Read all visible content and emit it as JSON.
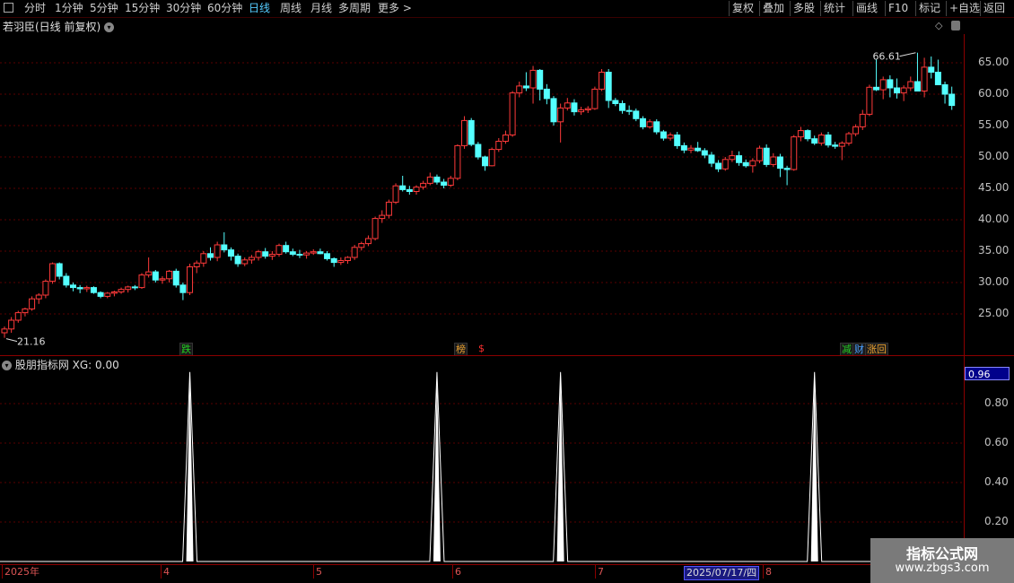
{
  "toolbar": {
    "periods": [
      "分时",
      "1分钟",
      "5分钟",
      "15分钟",
      "30分钟",
      "60分钟",
      "日线",
      "周线",
      "月线",
      "多周期",
      "更多 >"
    ],
    "active_period": "日线",
    "right_buttons": [
      "复权",
      "叠加",
      "多股",
      "统计",
      "画线",
      "F10",
      "标记",
      "+自选",
      "返回"
    ]
  },
  "chart": {
    "title": "若羽臣(日线 前复权)",
    "max_label": "66.61",
    "min_label": "21.16",
    "price_axis": [
      "65.00",
      "60.00",
      "55.00",
      "50.00",
      "45.00",
      "40.00",
      "35.00",
      "30.00",
      "25.00"
    ],
    "signals": [
      {
        "text": "跌",
        "color": "#22cc22"
      },
      {
        "text": "榜",
        "color": "#e8a030"
      },
      {
        "text": "$",
        "color": "#ff3030"
      },
      {
        "text": "减",
        "color": "#22cc22"
      },
      {
        "text": "财",
        "color": "#4aa0ff"
      },
      {
        "text": "涨回",
        "color": "#e8a030"
      }
    ]
  },
  "indicator": {
    "title": "股朋指标网 XG: 0.00",
    "current_value": "0.96",
    "axis": [
      "0.80",
      "0.60",
      "0.40",
      "0.20"
    ]
  },
  "date_axis": {
    "labels": [
      "2025年",
      "4",
      "5",
      "6",
      "7",
      "8"
    ],
    "cursor_date": "2025/07/17/四"
  },
  "watermark": {
    "line1": "指标公式网",
    "line2": "www.zbgs3.com"
  },
  "chart_data": {
    "type": "candlestick",
    "title": "若羽臣(日线 前复权)",
    "ohlc": [
      [
        22,
        23,
        21.2,
        22.6
      ],
      [
        22.6,
        24.5,
        22,
        24
      ],
      [
        24,
        25.5,
        23.6,
        25.2
      ],
      [
        25.2,
        26,
        24.6,
        25.8
      ],
      [
        25.8,
        27.8,
        25.5,
        27.4
      ],
      [
        27.4,
        28.3,
        26.6,
        28
      ],
      [
        28,
        30.5,
        27.5,
        30.2
      ],
      [
        30.2,
        33.2,
        29.8,
        33
      ],
      [
        33,
        33.2,
        30.5,
        31
      ],
      [
        31,
        31.5,
        29.2,
        29.6
      ],
      [
        29.6,
        30,
        28.6,
        29.2
      ],
      [
        29.2,
        29.6,
        28.3,
        29
      ],
      [
        29,
        29.5,
        28.5,
        29.2
      ],
      [
        29.2,
        29.4,
        28.2,
        28.4
      ],
      [
        28.4,
        28.6,
        27.5,
        27.8
      ],
      [
        27.8,
        28.5,
        27.5,
        28.3
      ],
      [
        28.3,
        28.7,
        27.8,
        28.5
      ],
      [
        28.5,
        29.2,
        28.2,
        28.9
      ],
      [
        28.9,
        29.5,
        28.4,
        29.3
      ],
      [
        29.3,
        29.6,
        28.8,
        29.2
      ],
      [
        29.2,
        31.5,
        29,
        31.2
      ],
      [
        31.2,
        34,
        30.8,
        31.7
      ],
      [
        31.7,
        32,
        30,
        30.4
      ],
      [
        30.4,
        31,
        29.8,
        30.6
      ],
      [
        30.6,
        32,
        30,
        31.8
      ],
      [
        31.8,
        32.2,
        29.2,
        29.6
      ],
      [
        29.6,
        30,
        27.2,
        28.4
      ],
      [
        28.4,
        33,
        28,
        32.5
      ],
      [
        32.5,
        33.5,
        31.5,
        33.1
      ],
      [
        33.1,
        35,
        32.5,
        34.6
      ],
      [
        34.6,
        35.6,
        33.5,
        34
      ],
      [
        34,
        36.5,
        33.4,
        36
      ],
      [
        36,
        38,
        34.8,
        35.2
      ],
      [
        35.2,
        35.6,
        33.5,
        34.2
      ],
      [
        34.2,
        34.6,
        32.5,
        33
      ],
      [
        33,
        34,
        32.6,
        33.6
      ],
      [
        33.6,
        34.4,
        33,
        34
      ],
      [
        34,
        35.2,
        33.5,
        34.9
      ],
      [
        34.9,
        35.5,
        33.8,
        34.2
      ],
      [
        34.2,
        35,
        33.6,
        34.5
      ],
      [
        34.5,
        36.2,
        34.1,
        35.9
      ],
      [
        35.9,
        36.5,
        34.6,
        34.9
      ],
      [
        34.9,
        35.4,
        34.2,
        34.5
      ],
      [
        34.5,
        35.2,
        33.9,
        34.4
      ],
      [
        34.4,
        35,
        33.8,
        34.7
      ],
      [
        34.7,
        35.3,
        34.4,
        34.9
      ],
      [
        34.9,
        35.4,
        34.5,
        34.6
      ],
      [
        34.6,
        35,
        33.5,
        33.8
      ],
      [
        33.8,
        34,
        32.5,
        33.2
      ],
      [
        33.2,
        34,
        32.8,
        33.5
      ],
      [
        33.5,
        34.2,
        33,
        34
      ],
      [
        34,
        36,
        33.6,
        35.6
      ],
      [
        35.6,
        36.5,
        35.1,
        36.2
      ],
      [
        36.2,
        37.5,
        35.8,
        37
      ],
      [
        37,
        40.5,
        36.7,
        40.2
      ],
      [
        40.2,
        41.5,
        39.5,
        40.7
      ],
      [
        40.7,
        43.2,
        40.2,
        42.8
      ],
      [
        42.8,
        45.8,
        42.5,
        45.4
      ],
      [
        45.4,
        47,
        44.5,
        44.8
      ],
      [
        44.8,
        45.4,
        44,
        44.5
      ],
      [
        44.5,
        45.5,
        44,
        45.2
      ],
      [
        45.2,
        46.2,
        44.8,
        45.8
      ],
      [
        45.8,
        47.5,
        45.5,
        46.8
      ],
      [
        46.8,
        47.2,
        45.6,
        46
      ],
      [
        46,
        46.5,
        45,
        45.5
      ],
      [
        45.5,
        47,
        45.2,
        46.6
      ],
      [
        46.6,
        52,
        46.3,
        51.8
      ],
      [
        51.8,
        56.5,
        51.3,
        55.8
      ],
      [
        55.8,
        56.2,
        51.7,
        52
      ],
      [
        52,
        52.4,
        49.6,
        50
      ],
      [
        50,
        50.2,
        47.8,
        48.6
      ],
      [
        48.6,
        51.5,
        48.5,
        51.2
      ],
      [
        51.2,
        53,
        50.8,
        52.5
      ],
      [
        52.5,
        54.2,
        52.1,
        53.5
      ],
      [
        53.5,
        60.5,
        53.2,
        60.2
      ],
      [
        60.2,
        62,
        59.5,
        61.3
      ],
      [
        61.3,
        63.5,
        60.5,
        61
      ],
      [
        61,
        64.5,
        58.5,
        63.8
      ],
      [
        63.8,
        64,
        59,
        60.8
      ],
      [
        60.8,
        61.6,
        58.4,
        59.3
      ],
      [
        59.3,
        59.7,
        55,
        55.6
      ],
      [
        55.6,
        58.5,
        52.3,
        57.8
      ],
      [
        57.8,
        59.4,
        57.4,
        58.6
      ],
      [
        58.6,
        59.2,
        56.6,
        57.2
      ],
      [
        57.2,
        58,
        56.7,
        57.5
      ],
      [
        57.5,
        58.1,
        57,
        57.7
      ],
      [
        57.7,
        61.2,
        57.5,
        60.8
      ],
      [
        60.8,
        64,
        60.5,
        63.5
      ],
      [
        63.5,
        64,
        57.8,
        59
      ],
      [
        59,
        59.4,
        58.1,
        58.5
      ],
      [
        58.5,
        59,
        56.9,
        57.4
      ],
      [
        57.4,
        58.2,
        56.7,
        57.3
      ],
      [
        57.3,
        57.7,
        55.7,
        56.1
      ],
      [
        56.1,
        56.5,
        54.4,
        54.8
      ],
      [
        54.8,
        56,
        54.5,
        55.6
      ],
      [
        55.6,
        56,
        53.6,
        54
      ],
      [
        54,
        54.3,
        52.6,
        53
      ],
      [
        53,
        53.9,
        52.6,
        53.5
      ],
      [
        53.5,
        54,
        51.3,
        51.8
      ],
      [
        51.8,
        52.3,
        50.6,
        51.1
      ],
      [
        51.1,
        51.9,
        50.6,
        51.4
      ],
      [
        51.4,
        52.4,
        50.8,
        51
      ],
      [
        51,
        51.4,
        49.8,
        50.3
      ],
      [
        50.3,
        50.8,
        48.4,
        49
      ],
      [
        49,
        49.5,
        47.6,
        48.1
      ],
      [
        48.1,
        50,
        47.8,
        49.6
      ],
      [
        49.6,
        51,
        49.2,
        50.2
      ],
      [
        50.2,
        50.9,
        48.6,
        49.1
      ],
      [
        49.1,
        49.6,
        48.3,
        48.6
      ],
      [
        48.6,
        49.8,
        47.5,
        49.4
      ],
      [
        49.4,
        51.8,
        49,
        51.4
      ],
      [
        51.4,
        52,
        48.4,
        48.8
      ],
      [
        48.8,
        50.6,
        48.4,
        50
      ],
      [
        50,
        50.5,
        46.8,
        48.2
      ],
      [
        48.2,
        48.6,
        45.5,
        48
      ],
      [
        48,
        53.5,
        47.8,
        53.2
      ],
      [
        53.2,
        54.8,
        52.5,
        54.2
      ],
      [
        54.2,
        54.4,
        52.5,
        52.9
      ],
      [
        52.9,
        53.4,
        51.9,
        52.2
      ],
      [
        52.2,
        53.9,
        51.8,
        53.5
      ],
      [
        53.5,
        54,
        51.5,
        51.9
      ],
      [
        51.9,
        52.4,
        51.3,
        51.7
      ],
      [
        51.7,
        52.5,
        49.5,
        52.2
      ],
      [
        52.2,
        54,
        51.8,
        53.7
      ],
      [
        53.7,
        55.2,
        53.3,
        54.8
      ],
      [
        54.8,
        57.5,
        54.3,
        56.8
      ],
      [
        56.8,
        61.5,
        56.5,
        61.1
      ],
      [
        61.1,
        65.5,
        60.5,
        60.7
      ],
      [
        60.7,
        62.8,
        59.2,
        62.3
      ],
      [
        62.3,
        63,
        59.5,
        61
      ],
      [
        61,
        62.5,
        59.3,
        60.2
      ],
      [
        60.2,
        61.4,
        58.9,
        61
      ],
      [
        61,
        62.8,
        60.5,
        62
      ],
      [
        62,
        66.61,
        61.2,
        60.5
      ],
      [
        60.5,
        65.8,
        59.5,
        64.3
      ],
      [
        64.3,
        66,
        62.5,
        63.5
      ],
      [
        63.5,
        65.5,
        61.6,
        61.5
      ],
      [
        61.5,
        62,
        58.5,
        60
      ],
      [
        60,
        61.2,
        57.5,
        58.2
      ]
    ],
    "xg": {
      "peak_indices": [
        27,
        63,
        81,
        118
      ],
      "peak_value": 0.96,
      "ylim": [
        0,
        1
      ]
    },
    "ylim": [
      19,
      69
    ]
  }
}
